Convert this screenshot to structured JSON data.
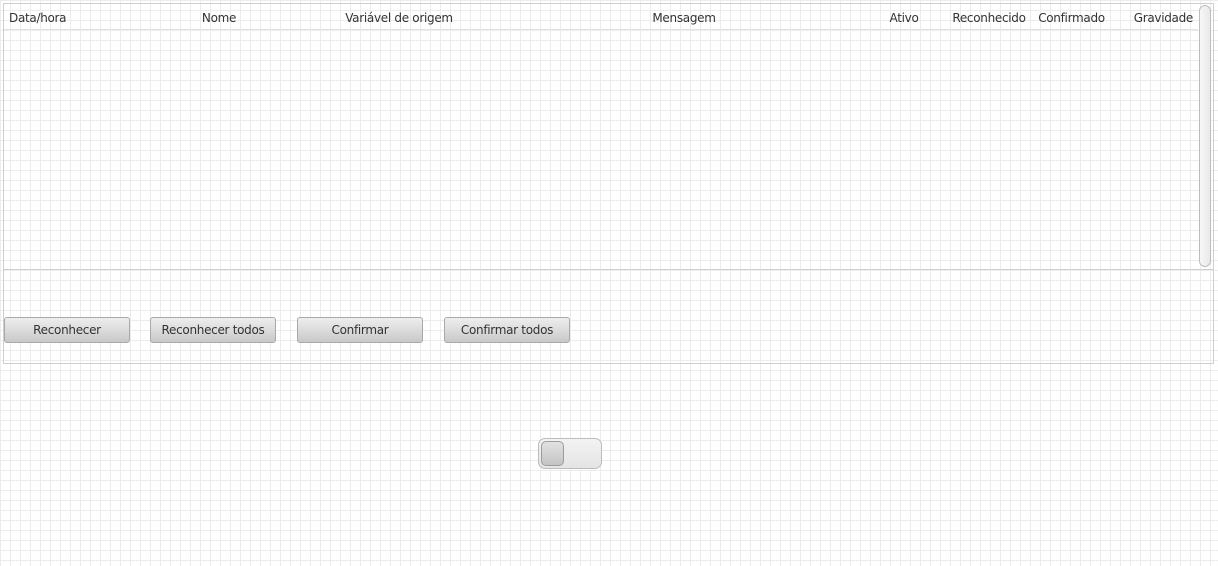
{
  "table": {
    "columns": [
      {
        "label": "Data/hora"
      },
      {
        "label": "Nome"
      },
      {
        "label": "Variável de origem"
      },
      {
        "label": "Mensagem"
      },
      {
        "label": "Ativo"
      },
      {
        "label": "Reconhecido"
      },
      {
        "label": "Confirmado"
      },
      {
        "label": "Gravidade"
      }
    ],
    "rows": []
  },
  "actions": {
    "acknowledge": "Reconhecer",
    "acknowledge_all": "Reconhecer todos",
    "confirm": "Confirmar",
    "confirm_all": "Confirmar todos"
  },
  "toggle": {
    "state": "off"
  }
}
